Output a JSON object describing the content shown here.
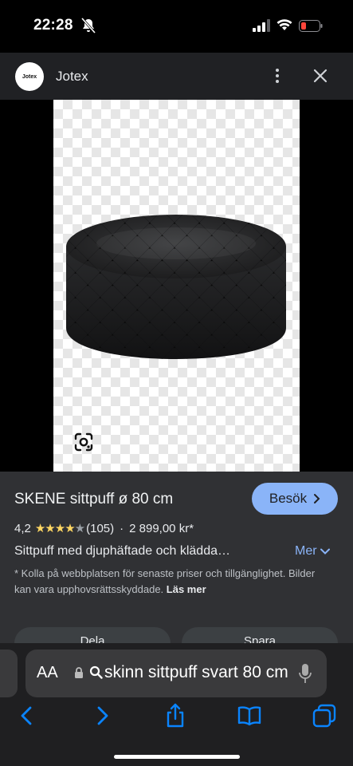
{
  "status_bar": {
    "time": "22:28",
    "icons": [
      "bell-slash-icon",
      "cellular-signal-icon",
      "wifi-icon",
      "battery-low-icon"
    ]
  },
  "header": {
    "logo_text": "Jotex",
    "site_name": "Jotex",
    "icons": [
      "more-vertical-icon",
      "close-icon"
    ]
  },
  "image": {
    "subject": "black tufted round ottoman",
    "icons": [
      "google-lens-icon"
    ]
  },
  "product": {
    "title": "SKENE sittpuff ø 80 cm",
    "visit_label": "Besök",
    "rating": "4,2",
    "stars_full": 4,
    "review_count": "(105)",
    "separator": "·",
    "price": "2 899,00 kr*",
    "description": "Sittpuff med djuphäftade och klädda…",
    "more_label": "Mer",
    "disclaimer": "* Kolla på webbplatsen för senaste priser och tillgänglighet. Bilder kan vara upphovsrättsskyddade.",
    "read_more": "Läs mer",
    "share_label": "Dela",
    "save_label": "Spara"
  },
  "safari": {
    "aa_label": "AA",
    "address": "skinn sittpuff svart 80 cm",
    "icons": [
      "lock-icon",
      "search-icon",
      "microphone-icon",
      "back-icon",
      "forward-icon",
      "share-icon",
      "bookmarks-icon",
      "tabs-icon"
    ]
  },
  "colors": {
    "accent": "#8ab4f8",
    "star": "#fdd663",
    "panel": "#303134",
    "header": "#202124",
    "battery_low": "#ff453a"
  }
}
